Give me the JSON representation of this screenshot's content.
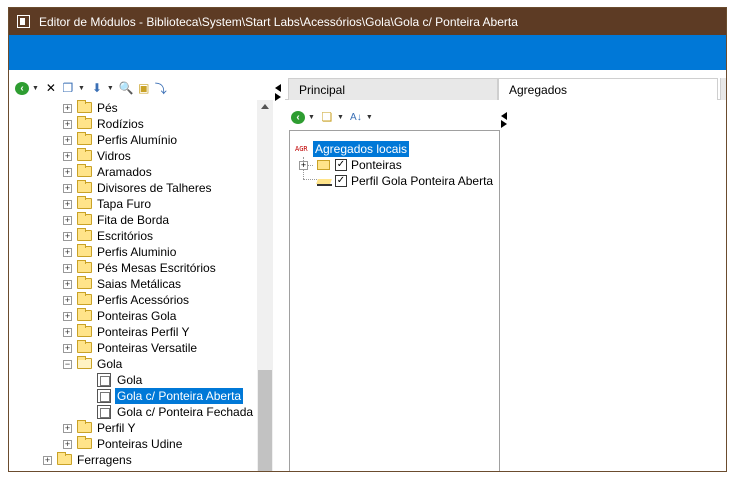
{
  "window": {
    "title": "Editor de Módulos - Biblioteca\\System\\Start Labs\\Acessórios\\Gola\\Gola c/ Ponteira Aberta"
  },
  "colors": {
    "titlebar": "#5d3b24",
    "ribbon": "#0078d7",
    "selection": "#0078d7",
    "folder": "#ffe48a"
  },
  "left_toolbar": {
    "icons": [
      "back-icon",
      "delete-icon",
      "copy-icon",
      "move-down-icon",
      "find-icon",
      "folder-refresh-icon",
      "link-icon"
    ]
  },
  "tree": {
    "items": [
      {
        "label": "Pés",
        "level": 3,
        "type": "folder",
        "expand": "+"
      },
      {
        "label": "Rodízios",
        "level": 3,
        "type": "folder",
        "expand": "+"
      },
      {
        "label": "Perfis Alumínio",
        "level": 3,
        "type": "folder",
        "expand": "+"
      },
      {
        "label": "Vidros",
        "level": 3,
        "type": "folder",
        "expand": "+"
      },
      {
        "label": "Aramados",
        "level": 3,
        "type": "folder",
        "expand": "+"
      },
      {
        "label": "Divisores de Talheres",
        "level": 3,
        "type": "folder",
        "expand": "+"
      },
      {
        "label": "Tapa Furo",
        "level": 3,
        "type": "folder",
        "expand": "+"
      },
      {
        "label": "Fita de Borda",
        "level": 3,
        "type": "folder",
        "expand": "+"
      },
      {
        "label": "Escritórios",
        "level": 3,
        "type": "folder",
        "expand": "+"
      },
      {
        "label": "Perfis Aluminio",
        "level": 3,
        "type": "folder",
        "expand": "+"
      },
      {
        "label": "Pés Mesas Escritórios",
        "level": 3,
        "type": "folder",
        "expand": "+"
      },
      {
        "label": "Saias Metálicas",
        "level": 3,
        "type": "folder",
        "expand": "+"
      },
      {
        "label": "Perfis Acessórios",
        "level": 3,
        "type": "folder",
        "expand": "+"
      },
      {
        "label": "Ponteiras Gola",
        "level": 3,
        "type": "folder",
        "expand": "+"
      },
      {
        "label": "Ponteiras Perfil Y",
        "level": 3,
        "type": "folder",
        "expand": "+"
      },
      {
        "label": "Ponteiras Versatile",
        "level": 3,
        "type": "folder",
        "expand": "+"
      },
      {
        "label": "Gola",
        "level": 3,
        "type": "folder-open",
        "expand": "−"
      },
      {
        "label": "Gola",
        "level": 4,
        "type": "doc"
      },
      {
        "label": "Gola c/ Ponteira Aberta",
        "level": 4,
        "type": "doc",
        "selected": true
      },
      {
        "label": "Gola c/ Ponteira Fechada",
        "level": 4,
        "type": "doc"
      },
      {
        "label": "Perfil Y",
        "level": 3,
        "type": "folder",
        "expand": "+"
      },
      {
        "label": "Ponteiras Udine",
        "level": 3,
        "type": "folder",
        "expand": "+"
      },
      {
        "label": "Ferragens",
        "level": 2,
        "type": "folder",
        "expand": "+"
      }
    ]
  },
  "tabs": [
    {
      "label": "Principal",
      "active": false
    },
    {
      "label": "Agregados",
      "active": true
    }
  ],
  "agg_toolbar": {
    "icons": [
      "back-icon",
      "new-item-icon",
      "sort-az-icon"
    ]
  },
  "aggregates": {
    "root_tag": "AGR",
    "root_label": "Agregados locais",
    "items": [
      {
        "label": "Ponteiras",
        "checked": true,
        "icon": "folder-icon",
        "expand": "+"
      },
      {
        "label": "Perfil Gola Ponteira Aberta",
        "checked": true,
        "icon": "profile-icon"
      }
    ]
  }
}
